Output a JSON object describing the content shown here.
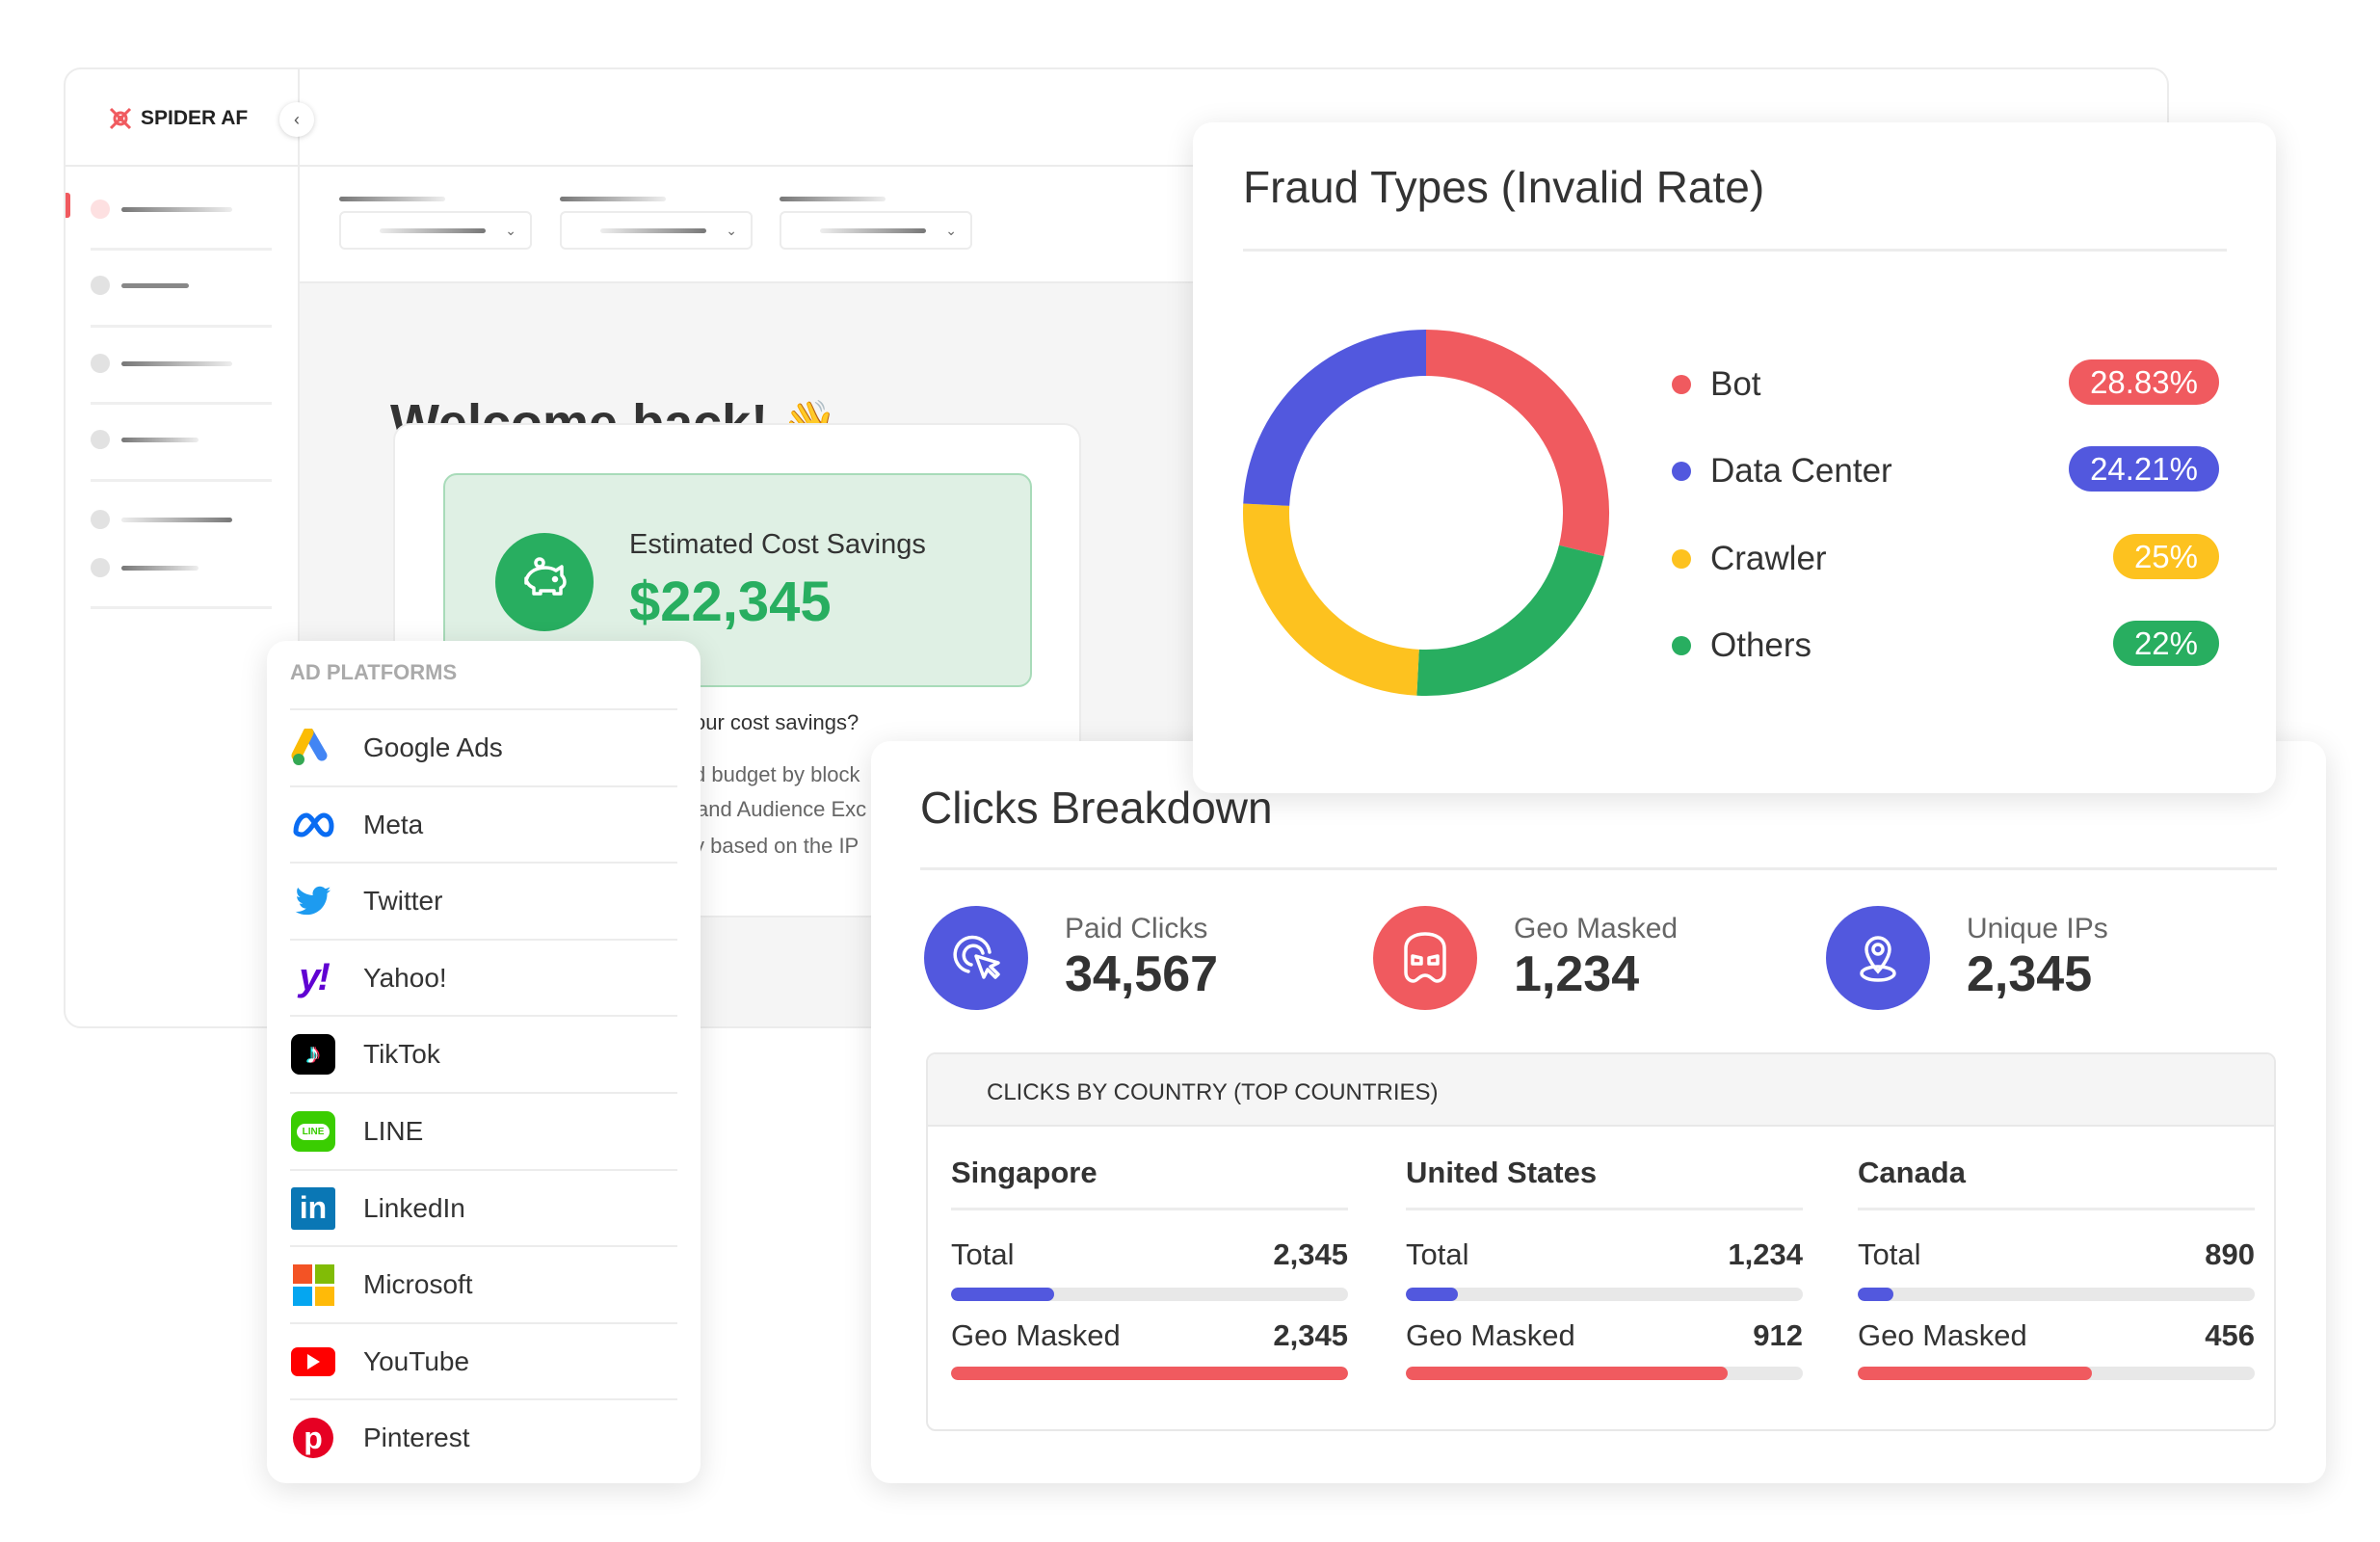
{
  "app": {
    "brand": "SPIDER AF",
    "collapse_icon": "chevron-left-icon"
  },
  "welcome": {
    "title": "Welcome back!",
    "emoji": "👋"
  },
  "savings": {
    "label": "Estimated Cost Savings",
    "value": "$22,345",
    "icon": "piggy-bank-icon"
  },
  "info": {
    "question": "our cost savings?",
    "lines": [
      "d budget by block",
      "and Audience Exc",
      "y based on the IP"
    ]
  },
  "platforms": {
    "header": "AD PLATFORMS",
    "items": [
      {
        "label": "Google Ads",
        "icon": "google-ads-icon"
      },
      {
        "label": "Meta",
        "icon": "meta-icon"
      },
      {
        "label": "Twitter",
        "icon": "twitter-icon"
      },
      {
        "label": "Yahoo!",
        "icon": "yahoo-icon"
      },
      {
        "label": "TikTok",
        "icon": "tiktok-icon"
      },
      {
        "label": "LINE",
        "icon": "line-icon"
      },
      {
        "label": "LinkedIn",
        "icon": "linkedin-icon"
      },
      {
        "label": "Microsoft",
        "icon": "microsoft-icon"
      },
      {
        "label": "YouTube",
        "icon": "youtube-icon"
      },
      {
        "label": "Pinterest",
        "icon": "pinterest-icon"
      }
    ]
  },
  "fraud": {
    "title": "Fraud Types (Invalid Rate)",
    "items": [
      {
        "label": "Bot",
        "value": "28.83%",
        "pct": 28.83,
        "color": "#f05a5f"
      },
      {
        "label": "Data Center",
        "value": "24.21%",
        "pct": 24.21,
        "color": "#5258de"
      },
      {
        "label": "Crawler",
        "value": "25%",
        "pct": 25,
        "color": "#fdc21f"
      },
      {
        "label": "Others",
        "value": "22%",
        "pct": 22,
        "color": "#28ae60"
      }
    ]
  },
  "clicks": {
    "title": "Clicks Breakdown",
    "stats": [
      {
        "label": "Paid Clicks",
        "value": "34,567",
        "icon": "cursor-click-icon",
        "color": "#5258de"
      },
      {
        "label": "Geo Masked",
        "value": "1,234",
        "icon": "mask-icon",
        "color": "#f05a5f"
      },
      {
        "label": "Unique IPs",
        "value": "2,345",
        "icon": "location-pin-icon",
        "color": "#5258de"
      }
    ],
    "country_header": "CLICKS BY COUNTRY (TOP COUNTRIES)",
    "countries": [
      {
        "name": "Singapore",
        "total_label": "Total",
        "total": "2,345",
        "total_fill": 0.26,
        "geo_label": "Geo Masked",
        "geo": "2,345",
        "geo_fill": 1.0
      },
      {
        "name": "United States",
        "total_label": "Total",
        "total": "1,234",
        "total_fill": 0.13,
        "geo_label": "Geo Masked",
        "geo": "912",
        "geo_fill": 0.81
      },
      {
        "name": "Canada",
        "total_label": "Total",
        "total": "890",
        "total_fill": 0.09,
        "geo_label": "Geo Masked",
        "geo": "456",
        "geo_fill": 0.59
      }
    ]
  },
  "colors": {
    "accent_red": "#f05a5f",
    "accent_blue": "#5258de",
    "green": "#28ae60",
    "yellow": "#fdc21f"
  }
}
